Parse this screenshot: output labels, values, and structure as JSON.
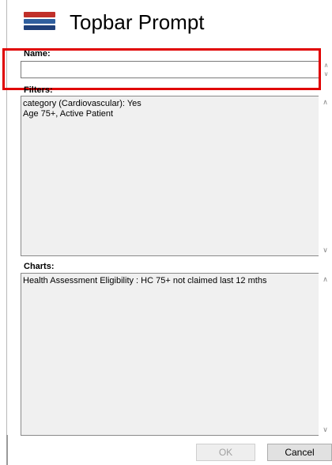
{
  "header": {
    "title": "Topbar Prompt",
    "logo_icon": "stacked-layers-icon"
  },
  "name": {
    "label": "Name:",
    "value": ""
  },
  "filters": {
    "label": "Filters:",
    "text": "category (Cardiovascular): Yes\nAge 75+, Active Patient"
  },
  "charts": {
    "label": "Charts:",
    "text": "Health Assessment Eligibility : HC 75+ not claimed last 12 mths"
  },
  "buttons": {
    "ok": "OK",
    "cancel": "Cancel"
  },
  "colors": {
    "highlight": "#e00000",
    "logo_red": "#c0302a",
    "logo_blue": "#2f5f9e"
  }
}
